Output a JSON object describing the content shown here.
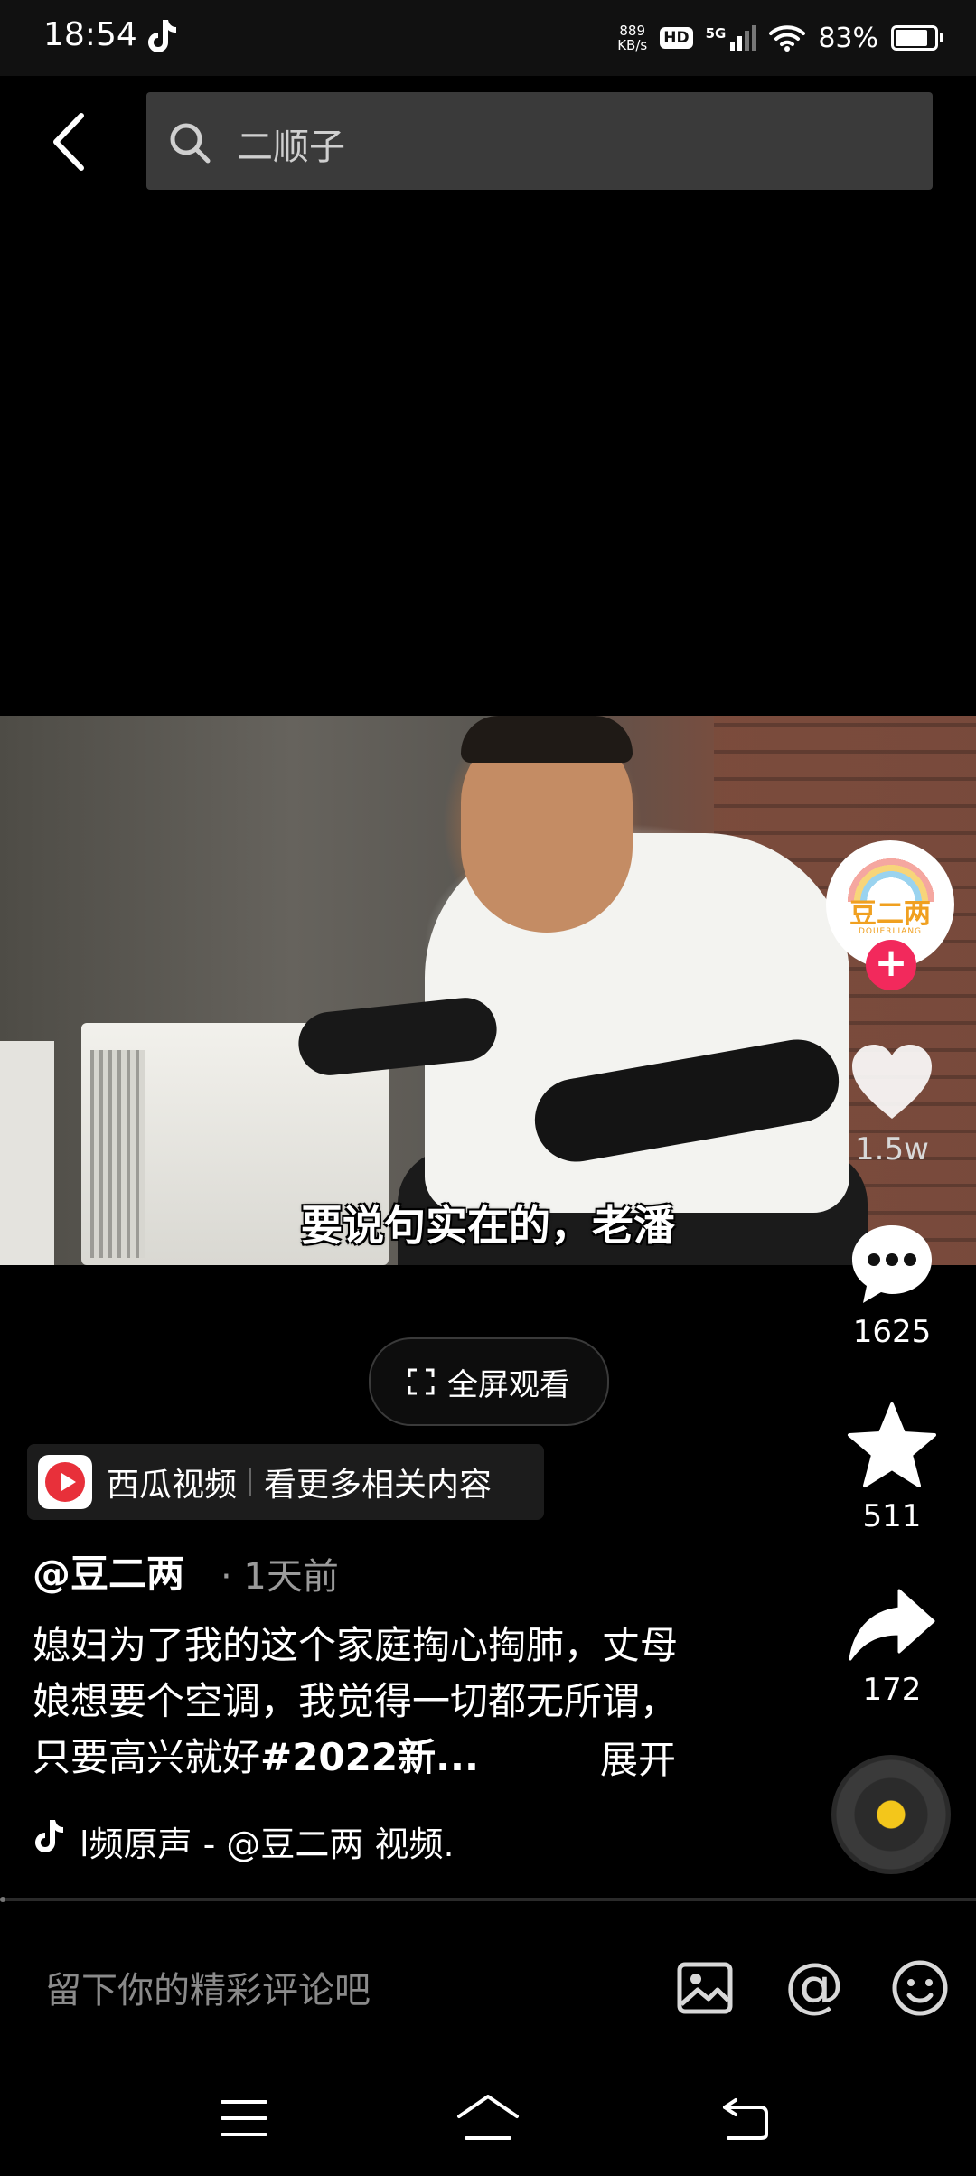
{
  "status_bar": {
    "time": "18:54",
    "net_speed_value": "889",
    "net_speed_unit": "KB/s",
    "hd_label": "HD",
    "signal_label": "5G",
    "battery_percent": "83%"
  },
  "search": {
    "query": "二顺子"
  },
  "video": {
    "subtitle": "要说句实在的，老潘"
  },
  "right_rail": {
    "avatar_logo": "豆二两",
    "avatar_sub": "DOUERLIANG",
    "follow_icon": "+",
    "like_count": "1.5w",
    "comment_count": "1625",
    "favorite_count": "511",
    "share_count": "172"
  },
  "fullscreen_button": {
    "label": "全屏观看"
  },
  "xigua": {
    "name": "西瓜视频",
    "more": "看更多相关内容"
  },
  "post": {
    "author": "@豆二两",
    "time": "· 1天前",
    "caption_text": "媳妇为了我的这个家庭掏心掏肺，丈母娘想要个空调，我觉得一切都无所谓，只要高兴就好",
    "caption_tag": "#2022新...",
    "expand_label": "展开",
    "music": "l频原声 - @豆二两    视频."
  },
  "comment_bar": {
    "placeholder": "留下你的精彩评论吧",
    "at_symbol": "@"
  },
  "icons": {
    "back": "chevron-left-icon",
    "search": "search-icon",
    "like": "heart-icon",
    "comment": "comment-bubble-icon",
    "favorite": "star-icon",
    "share": "share-arrow-icon",
    "music": "tiktok-note-icon",
    "image": "image-icon",
    "emoji": "smiley-icon",
    "nav_menu": "menu-icon",
    "nav_home": "home-icon",
    "nav_back": "back-icon"
  },
  "colors": {
    "background": "#000000",
    "search_bg": "#3a3a3a",
    "follow_red": "#f2295c",
    "disc_yellow": "#f3c61b",
    "muted_text": "#9a9a9a"
  }
}
